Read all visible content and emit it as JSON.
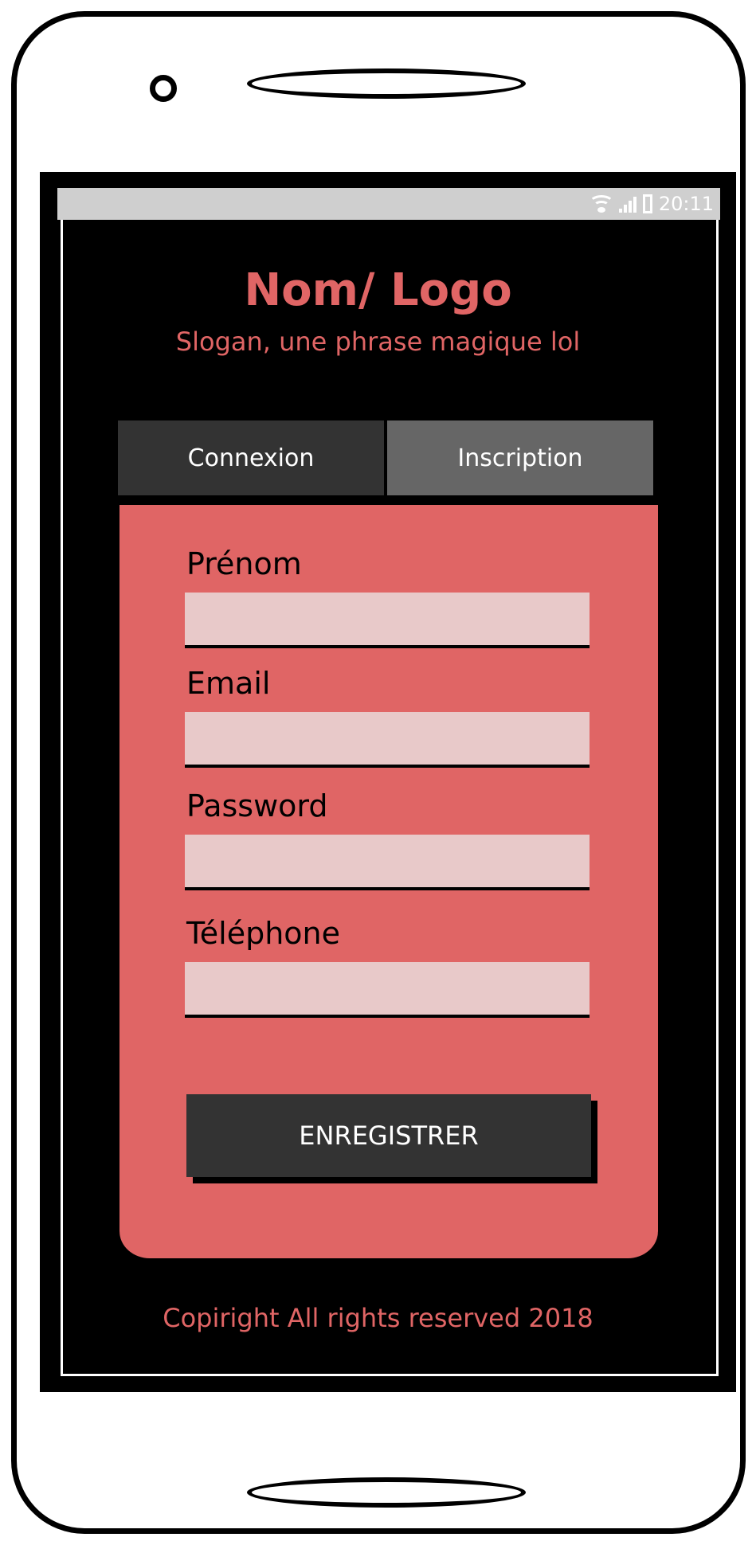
{
  "statusbar": {
    "time": "20:11",
    "icons": [
      "wifi-icon",
      "signal-icon",
      "battery-icon"
    ]
  },
  "brand": {
    "title": "Nom/ Logo",
    "slogan": "Slogan, une phrase magique lol"
  },
  "tabs": [
    {
      "label": "Connexion"
    },
    {
      "label": "Inscription"
    }
  ],
  "form": {
    "fields": [
      {
        "label": "Prénom",
        "value": ""
      },
      {
        "label": "Email",
        "value": ""
      },
      {
        "label": "Password",
        "value": ""
      },
      {
        "label": "Téléphone",
        "value": ""
      }
    ],
    "submit_label": "ENREGISTRER"
  },
  "footer": {
    "text": "Copiright All rights reserved 2018"
  },
  "colors": {
    "accent": "#e06565",
    "input_bg": "#e8c9c9",
    "tab_dark": "#333333",
    "tab_light": "#666666",
    "screen_bg": "#000000"
  }
}
